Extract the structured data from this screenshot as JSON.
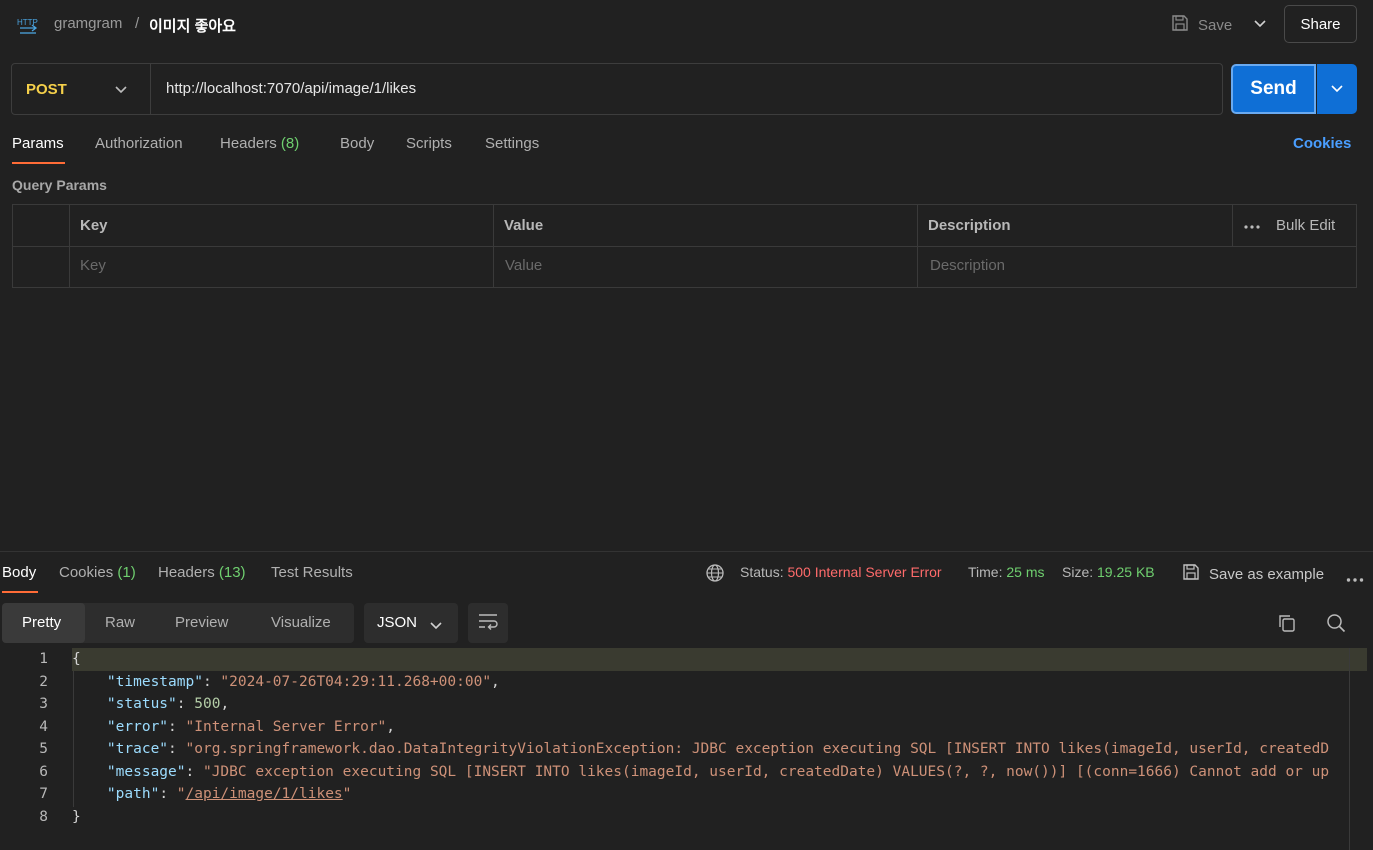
{
  "header": {
    "collection": "gramgram",
    "separator": "/",
    "request_name": "이미지 좋아요",
    "save_label": "Save",
    "share_label": "Share"
  },
  "request": {
    "method": "POST",
    "url": "http://localhost:7070/api/image/1/likes",
    "send_label": "Send"
  },
  "request_tabs": {
    "params": "Params",
    "authorization": "Authorization",
    "headers": "Headers",
    "headers_count": "(8)",
    "body": "Body",
    "scripts": "Scripts",
    "settings": "Settings",
    "cookies": "Cookies"
  },
  "query_params": {
    "title": "Query Params",
    "columns": {
      "key": "Key",
      "value": "Value",
      "description": "Description"
    },
    "bulk_edit": "Bulk Edit",
    "placeholders": {
      "key": "Key",
      "value": "Value",
      "description": "Description"
    }
  },
  "response_tabs": {
    "body": "Body",
    "cookies": "Cookies",
    "cookies_count": "(1)",
    "headers": "Headers",
    "headers_count": "(13)",
    "test_results": "Test Results"
  },
  "response_meta": {
    "status_label": "Status:",
    "status_value": "500 Internal Server Error",
    "time_label": "Time:",
    "time_value": "25 ms",
    "size_label": "Size:",
    "size_value": "19.25 KB",
    "save_example": "Save as example"
  },
  "response_format": {
    "pretty": "Pretty",
    "raw": "Raw",
    "preview": "Preview",
    "visualize": "Visualize",
    "language": "JSON"
  },
  "code": {
    "line_numbers": [
      "1",
      "2",
      "3",
      "4",
      "5",
      "6",
      "7",
      "8"
    ],
    "open_brace": "{",
    "close_brace": "}",
    "k_timestamp": "\"timestamp\"",
    "v_timestamp": "\"2024-07-26T04:29:11.268+00:00\"",
    "k_status": "\"status\"",
    "v_status": "500",
    "k_error": "\"error\"",
    "v_error": "\"Internal Server Error\"",
    "k_trace": "\"trace\"",
    "v_trace": "\"org.springframework.dao.DataIntegrityViolationException: JDBC exception executing SQL [INSERT INTO likes(imageId, userId, createdD",
    "k_message": "\"message\"",
    "v_message": "\"JDBC exception executing SQL [INSERT INTO likes(imageId, userId, createdDate) VALUES(?, ?, now())] [(conn=1666) Cannot add or up",
    "k_path": "\"path\"",
    "v_path_quote_open": "\"",
    "v_path": "/api/image/1/likes",
    "v_path_quote_close": "\""
  },
  "colors": {
    "send": "#0f6fd6",
    "method": "#f5d04a",
    "status_error": "#ff6b6b",
    "success_green": "#6fcf6f",
    "accent_orange": "#ff6c37",
    "link_blue": "#4a9eff"
  }
}
